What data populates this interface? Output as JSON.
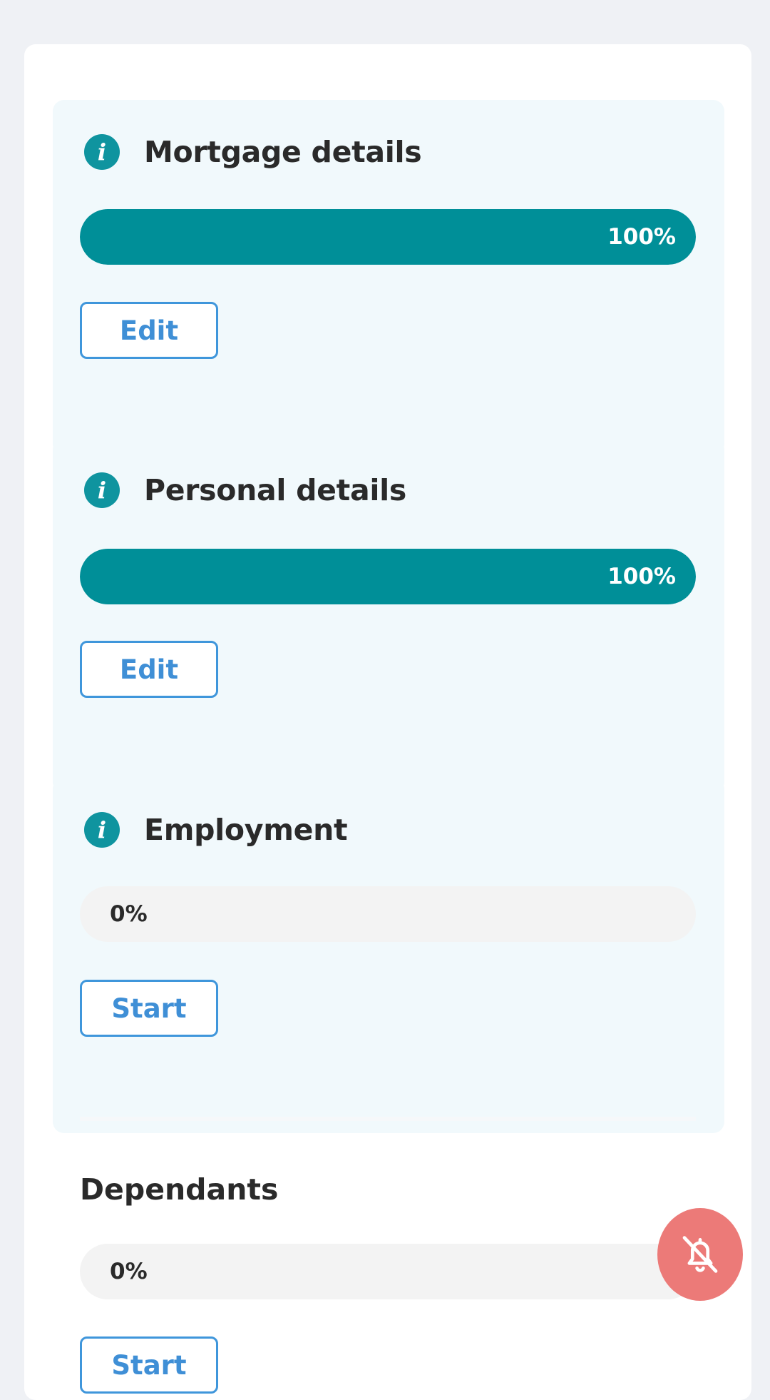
{
  "sections": [
    {
      "title": "Mortgage details",
      "icon": "info-icon",
      "progress": 100,
      "progress_label": "100%",
      "button_label": "Edit"
    },
    {
      "title": "Personal details",
      "icon": "info-icon",
      "progress": 100,
      "progress_label": "100%",
      "button_label": "Edit"
    },
    {
      "title": "Employment",
      "icon": "info-icon",
      "progress": 0,
      "progress_label": "0%",
      "button_label": "Start"
    },
    {
      "title": "Dependants",
      "progress": 0,
      "progress_label": "0%",
      "button_label": "Start"
    }
  ],
  "info_icon_glyph": "i",
  "fab": {
    "icon": "bell-off-icon"
  },
  "colors": {
    "accent": "#008f98",
    "button_border": "#3f96db",
    "fab": "#ec7a78"
  }
}
